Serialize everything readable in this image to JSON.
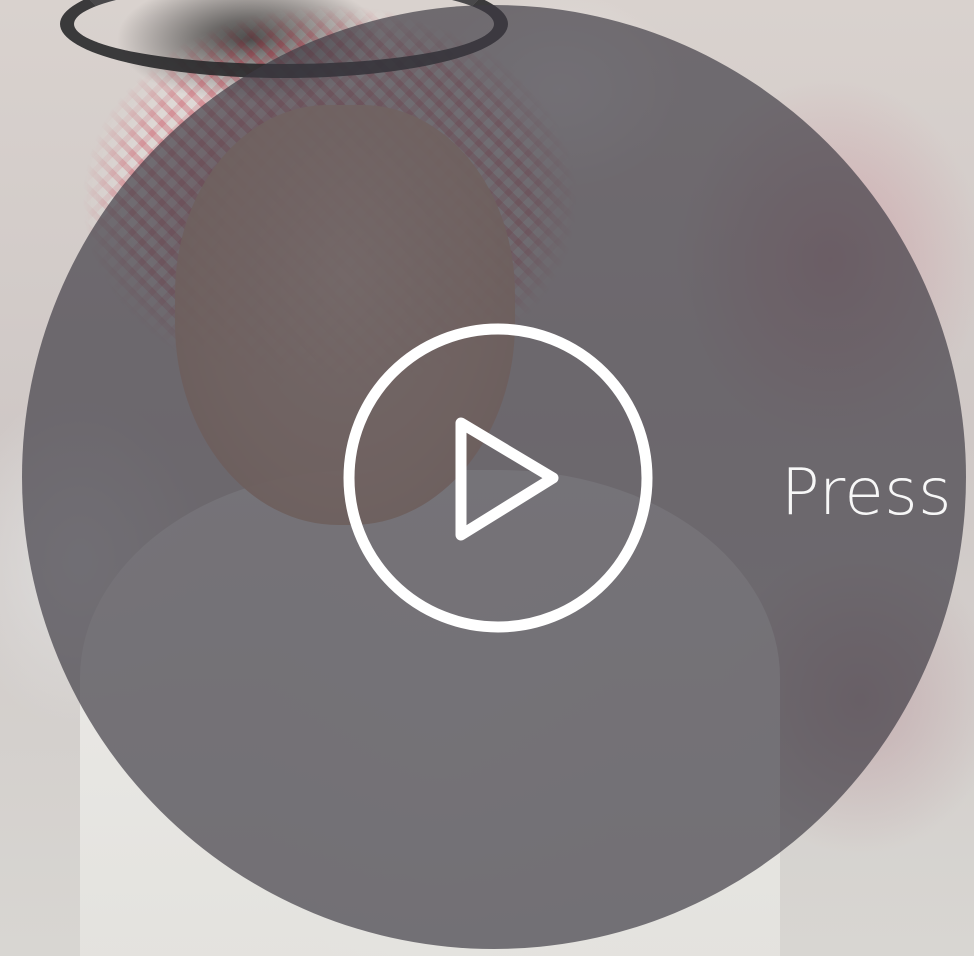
{
  "video": {
    "play_label": "Press T"
  },
  "colors": {
    "overlay": "#3c3a42",
    "play_icon": "#ffffff",
    "label": "#ffffff"
  },
  "icons": {
    "play": "play-circle-icon"
  }
}
